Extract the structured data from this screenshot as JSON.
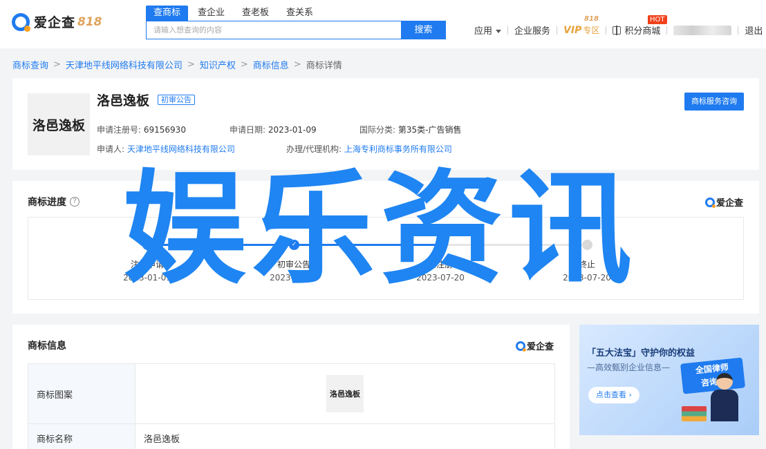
{
  "header": {
    "brand": "爱企查",
    "brand_badge": "818",
    "search_tabs": [
      {
        "label": "查商标",
        "active": true
      },
      {
        "label": "查企业",
        "active": false
      },
      {
        "label": "查老板",
        "active": false
      },
      {
        "label": "查关系",
        "active": false
      }
    ],
    "search_placeholder": "请输入想查询的内容",
    "search_button": "搜索",
    "nav": {
      "apps": "应用",
      "enterprise_service": "企业服务",
      "vip": "VIP",
      "vip_zone": "专区",
      "vip_tag": "818",
      "points_mall": "积分商城",
      "hot_badge": "HOT",
      "logout": "退出"
    }
  },
  "breadcrumb": [
    {
      "label": "商标查询",
      "link": true
    },
    {
      "label": "天津地平线网络科技有限公司",
      "link": true
    },
    {
      "label": "知识产权",
      "link": true
    },
    {
      "label": "商标信息",
      "link": true
    },
    {
      "label": "商标详情",
      "link": false
    }
  ],
  "summary": {
    "thumb_text": "洛邑逸板",
    "name": "洛邑逸板",
    "status": "初审公告",
    "reg_no_label": "申请注册号:",
    "reg_no": "69156930",
    "apply_date_label": "申请日期:",
    "apply_date": "2023-01-09",
    "intl_class_label": "国际分类:",
    "intl_class": "第35类-广告销售",
    "applicant_label": "申请人:",
    "applicant": "天津地平线网络科技有限公司",
    "agent_label": "办理/代理机构:",
    "agent": "上海专利商标事务所有限公司",
    "service_button": "商标服务咨询"
  },
  "progress": {
    "title": "商标进度",
    "brand": "爱企查",
    "steps": [
      {
        "label": "注册申请",
        "date": "2023-01-09",
        "done": true
      },
      {
        "label": "初审公告",
        "date": "2023-04-20",
        "done": true
      },
      {
        "label": "已注册",
        "date": "2023-07-20",
        "done": false
      },
      {
        "label": "终止",
        "date": "2033-07-20",
        "done": false
      }
    ]
  },
  "info": {
    "title": "商标信息",
    "brand": "爱企查",
    "rows": [
      {
        "label": "商标图案",
        "value": "洛邑逸板"
      },
      {
        "label": "商标名称",
        "value": "洛邑逸板"
      }
    ]
  },
  "ad": {
    "title": "「五大法宝」守护你的权益",
    "subtitle": "—高效甄别企业信息—",
    "badge_line1": "全国律师",
    "badge_line2": "咨询日",
    "button": "点击查看 ›"
  },
  "watermark": "娱乐资讯",
  "colors": {
    "accent": "#1f7bef",
    "watermark": "#1f85f2",
    "hot": "#f0421c",
    "vip_gold": "#e6a23c"
  }
}
